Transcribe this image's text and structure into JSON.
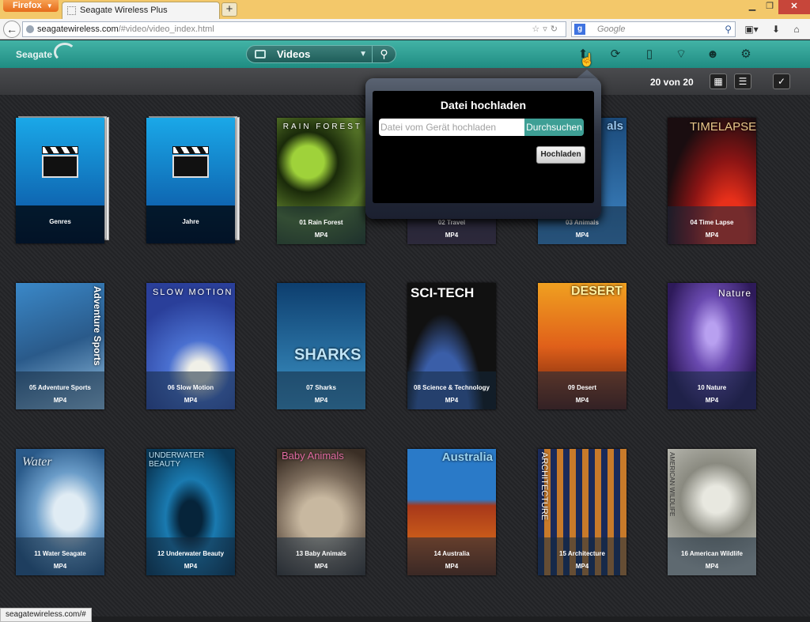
{
  "browser": {
    "menu_label": "Firefox",
    "tab_title": "Seagate Wireless Plus",
    "new_tab_label": "+",
    "url_host": "seagatewireless.com",
    "url_path": "/#video/video_index.html",
    "search_engine": "g",
    "search_placeholder": "Google",
    "status_url": "seagatewireless.com/#"
  },
  "app": {
    "logo_text": "Seagate",
    "media_type": "Videos",
    "accent_color": "#2fa398",
    "item_count": "20 von 20"
  },
  "upload_dialog": {
    "title": "Datei hochladen",
    "file_placeholder": "Datei vom Gerät hochladen",
    "browse_label": "Durchsuchen",
    "upload_label": "Hochladen"
  },
  "tiles": [
    {
      "name": "Genres",
      "format": "",
      "kind": "folder"
    },
    {
      "name": "Jahre",
      "format": "",
      "kind": "folder"
    },
    {
      "name": "01 Rain Forest",
      "format": "MP4",
      "art_text": "RAIN FOREST",
      "colors": [
        "#2e4a1e",
        "#7da33a"
      ]
    },
    {
      "name": "02 Travel",
      "format": "MP4",
      "art_text": "",
      "colors": [
        "#2a1b2a",
        "#4a2a3a"
      ]
    },
    {
      "name": "03 Animals",
      "format": "MP4",
      "art_text": "als",
      "colors": [
        "#1b4a7a",
        "#3e86c6"
      ]
    },
    {
      "name": "04 Time Lapse",
      "format": "MP4",
      "art_text": "TIMELAPSE",
      "colors": [
        "#1a0d10",
        "#b8282a"
      ]
    },
    {
      "name": "05 Adventure Sports",
      "format": "MP4",
      "art_text": "Adventure Sports",
      "colors": [
        "#2a6fb0",
        "#8cc2e8"
      ]
    },
    {
      "name": "06 Slow Motion",
      "format": "MP4",
      "art_text": "SLOW MOTION",
      "colors": [
        "#2a3f9a",
        "#6a90e0"
      ]
    },
    {
      "name": "07 Sharks",
      "format": "MP4",
      "art_text": "SHARKS",
      "colors": [
        "#0d3e6e",
        "#3d95c8"
      ]
    },
    {
      "name": "08 Science & Technology",
      "format": "MP4",
      "art_text": "SCI-TECH",
      "colors": [
        "#111",
        "#3a5ea8"
      ]
    },
    {
      "name": "09 Desert",
      "format": "MP4",
      "art_text": "DESERT",
      "colors": [
        "#e0881a",
        "#5a1a0a"
      ]
    },
    {
      "name": "10 Nature",
      "format": "MP4",
      "art_text": "Nature",
      "colors": [
        "#2e1a5a",
        "#8a6ac8"
      ]
    },
    {
      "name": "11 Water Seagate",
      "format": "MP4",
      "art_text": "Water",
      "colors": [
        "#6a9cc8",
        "#e0ecf4"
      ]
    },
    {
      "name": "12 Underwater Beauty",
      "format": "MP4",
      "art_text": "UNDERWATER BEAUTY",
      "colors": [
        "#1a7ab0",
        "#0a3a5a"
      ]
    },
    {
      "name": "13 Baby Animals",
      "format": "MP4",
      "art_text": "Baby Animals",
      "colors": [
        "#7a6a5a",
        "#c8b8a0"
      ]
    },
    {
      "name": "14 Australia",
      "format": "MP4",
      "art_text": "Australia",
      "colors": [
        "#2a7ac8",
        "#a8381a"
      ]
    },
    {
      "name": "15 Architecture",
      "format": "MP4",
      "art_text": "ARCHITECTURE",
      "colors": [
        "#1a2a5a",
        "#c87a2a"
      ]
    },
    {
      "name": "16 American Wildlife",
      "format": "MP4",
      "art_text": "AMERICAN WILDLIFE",
      "colors": [
        "#b8b8b0",
        "#6a6a60"
      ]
    }
  ]
}
